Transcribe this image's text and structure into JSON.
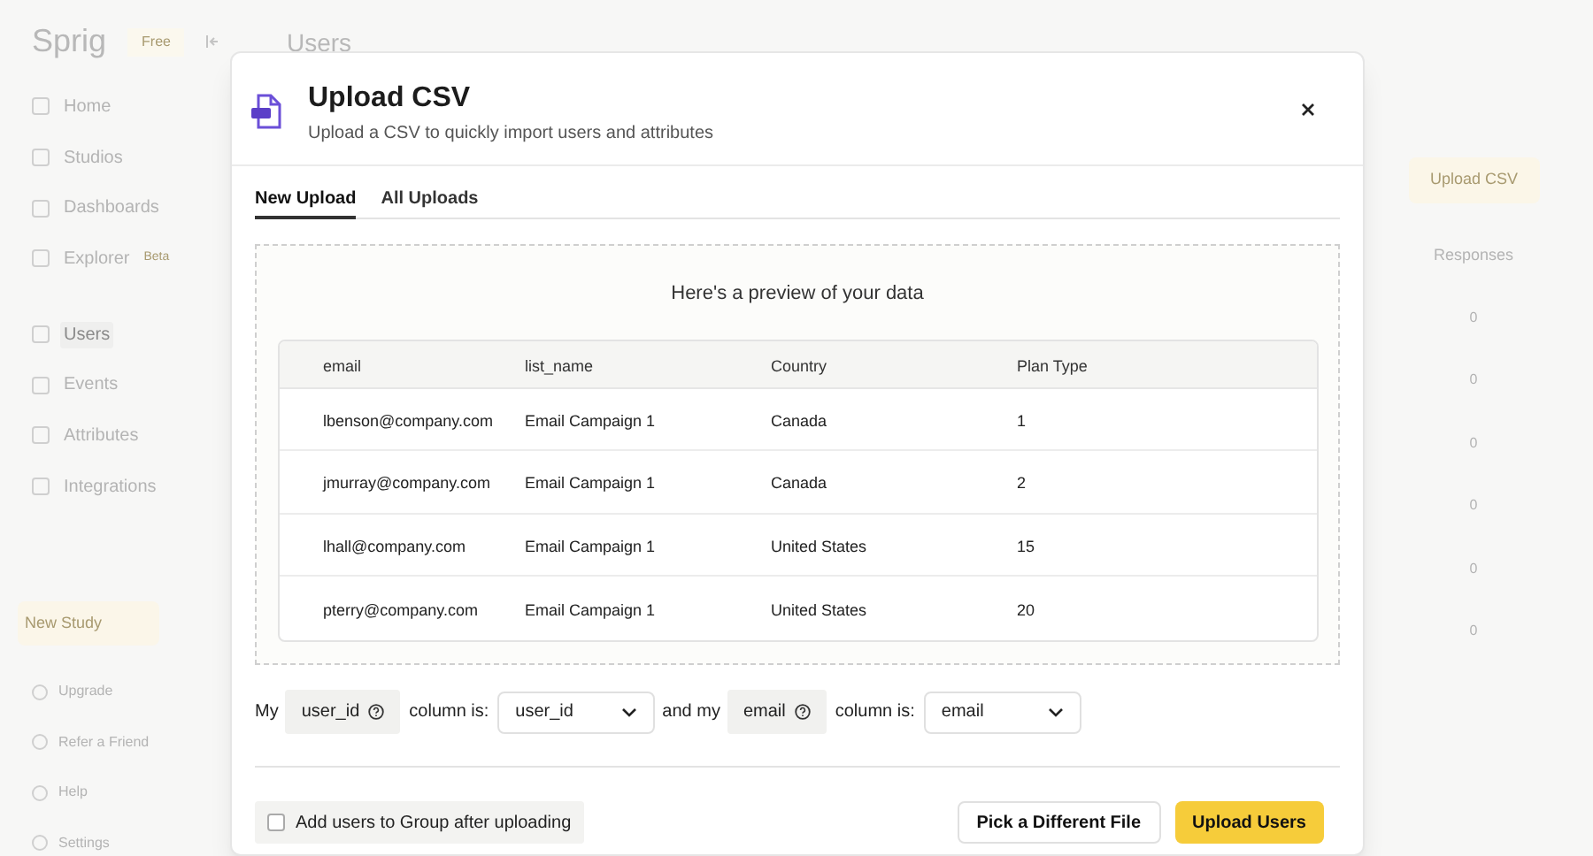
{
  "background": {
    "logo": "Sprig",
    "plan_badge": "Free",
    "page_title": "Users",
    "nav": [
      {
        "label": "Home",
        "selected": false
      },
      {
        "label": "Studios",
        "selected": false
      },
      {
        "label": "Dashboards",
        "selected": false
      },
      {
        "label": "Explorer",
        "badge": "Beta",
        "selected": false
      },
      {
        "label": "Users",
        "selected": true
      },
      {
        "label": "Events",
        "selected": false
      },
      {
        "label": "Attributes",
        "selected": false
      },
      {
        "label": "Integrations",
        "selected": false
      }
    ],
    "new_study_button": "New Study",
    "bottom_nav": [
      "Upgrade",
      "Refer a Friend",
      "Help",
      "Settings"
    ],
    "upload_button": "Upload CSV",
    "table": {
      "columns": [
        "Responses"
      ],
      "rows": [
        "0",
        "0",
        "0",
        "0",
        "0",
        "0"
      ]
    }
  },
  "dialog": {
    "title": "Upload CSV",
    "subtitle": "Upload a CSV to quickly import users and attributes",
    "tabs": [
      {
        "label": "New Upload",
        "selected": true
      },
      {
        "label": "All Uploads",
        "selected": false
      }
    ],
    "preview_heading": "Here's a preview of your data",
    "table": {
      "columns": [
        "email",
        "list_name",
        "Country",
        "Plan Type"
      ],
      "rows": [
        [
          "lbenson@company.com",
          "Email Campaign 1",
          "Canada",
          "1"
        ],
        [
          "jmurray@company.com",
          "Email Campaign 1",
          "Canada",
          "2"
        ],
        [
          "lhall@company.com",
          "Email Campaign 1",
          "United States",
          "15"
        ],
        [
          "pterry@company.com",
          "Email Campaign 1",
          "United States",
          "20"
        ]
      ]
    },
    "mapping": {
      "prefix": "My",
      "first_key": "user_id",
      "first_label": "column is:",
      "first_value": "user_id",
      "joiner": "and my",
      "second_key": "email",
      "second_label": "column is:",
      "second_value": "email"
    },
    "group_checkbox": {
      "label": "Add users to Group after uploading",
      "checked": false
    },
    "secondary_button": "Pick a Different File",
    "primary_button": "Upload Users"
  }
}
